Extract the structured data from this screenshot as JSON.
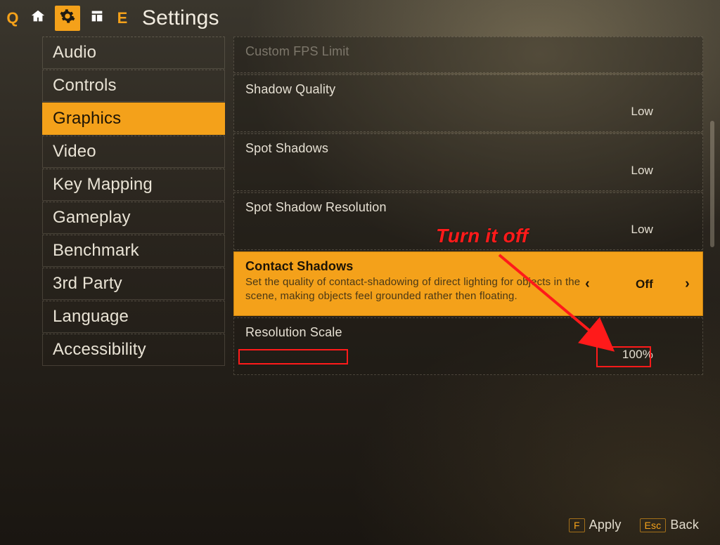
{
  "header": {
    "left_hotkey": "Q",
    "right_hotkey": "E",
    "title": "Settings",
    "tabs": [
      {
        "id": "home",
        "icon": "home-icon"
      },
      {
        "id": "settings",
        "icon": "gear-icon",
        "active": true
      },
      {
        "id": "loadout",
        "icon": "panel-icon"
      }
    ]
  },
  "sidebar": {
    "items": [
      {
        "id": "audio",
        "label": "Audio"
      },
      {
        "id": "controls",
        "label": "Controls"
      },
      {
        "id": "graphics",
        "label": "Graphics",
        "selected": true
      },
      {
        "id": "video",
        "label": "Video"
      },
      {
        "id": "keymapping",
        "label": "Key Mapping"
      },
      {
        "id": "gameplay",
        "label": "Gameplay"
      },
      {
        "id": "benchmark",
        "label": "Benchmark"
      },
      {
        "id": "thirdparty",
        "label": "3rd Party"
      },
      {
        "id": "language",
        "label": "Language"
      },
      {
        "id": "accessibility",
        "label": "Accessibility"
      }
    ]
  },
  "settings": {
    "rows": [
      {
        "id": "custom_fps_limit",
        "label": "Custom FPS Limit",
        "value": "",
        "disabled": true
      },
      {
        "id": "shadow_quality",
        "label": "Shadow Quality",
        "value": "Low"
      },
      {
        "id": "spot_shadows",
        "label": "Spot Shadows",
        "value": "Low"
      },
      {
        "id": "spot_shadow_resolution",
        "label": "Spot Shadow Resolution",
        "value": "Low"
      },
      {
        "id": "contact_shadows",
        "label": "Contact Shadows",
        "value": "Off",
        "description": "Set the quality of contact-shadowing of direct lighting for objects in the scene, making objects feel grounded rather then floating.",
        "selected": true
      },
      {
        "id": "resolution_scale",
        "label": "Resolution Scale",
        "value": "100%"
      }
    ]
  },
  "footer": {
    "apply": {
      "key": "F",
      "label": "Apply"
    },
    "back": {
      "key": "Esc",
      "label": "Back"
    }
  },
  "annotation": {
    "text": "Turn it off"
  }
}
